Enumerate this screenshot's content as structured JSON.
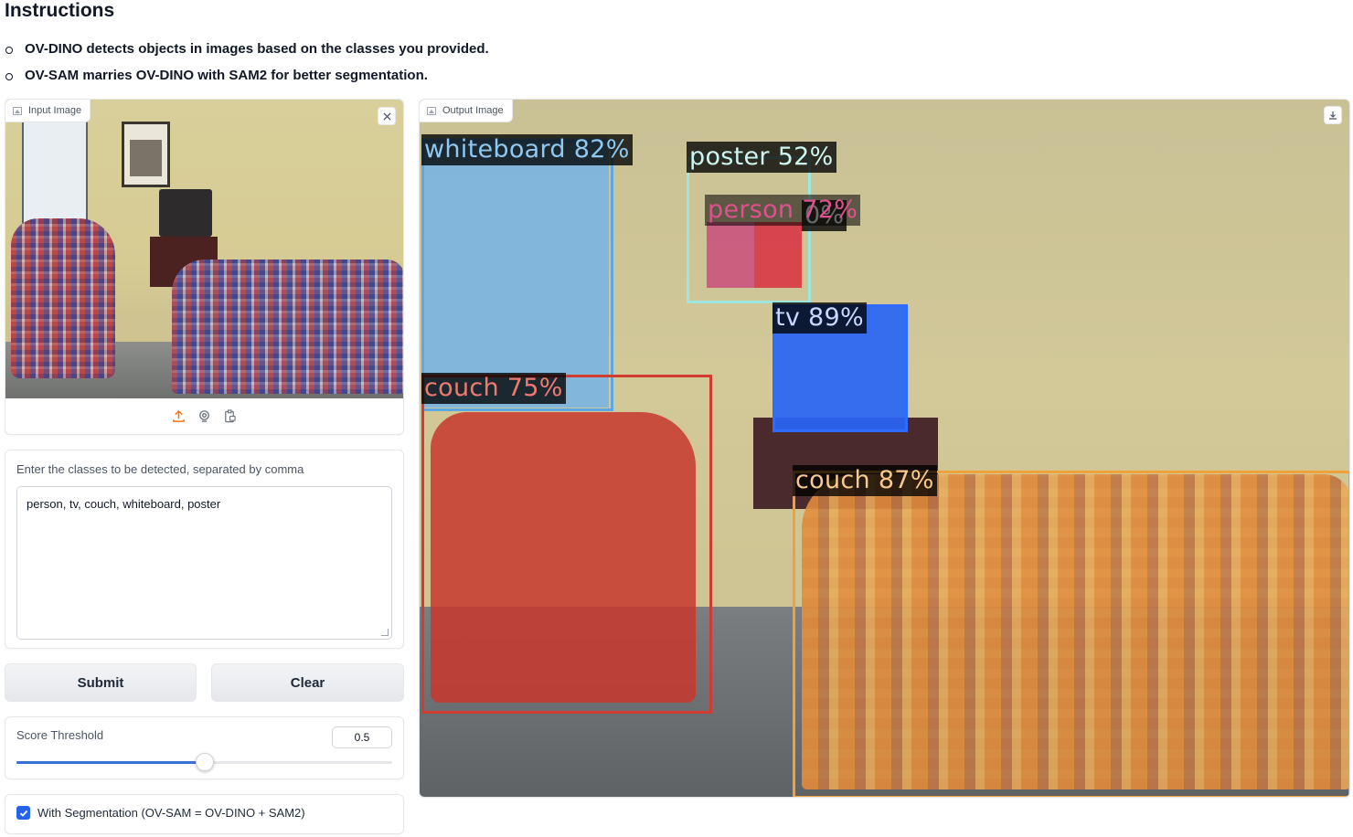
{
  "instructions": {
    "title": "Instructions",
    "items": [
      "OV-DINO detects objects in images based on the classes you provided.",
      "OV-SAM marries OV-DINO with SAM2 for better segmentation."
    ]
  },
  "input_image": {
    "label": "Input Image",
    "clear_icon": "close-icon",
    "source_icons": [
      "upload-icon",
      "webcam-icon",
      "clipboard-icon"
    ]
  },
  "classes": {
    "label": "Enter the classes to be detected, separated by comma",
    "value": "person, tv, couch, whiteboard, poster"
  },
  "buttons": {
    "submit": "Submit",
    "clear": "Clear"
  },
  "threshold": {
    "label": "Score Threshold",
    "value": "0.5",
    "fraction": 0.5
  },
  "segmentation": {
    "label": "With Segmentation (OV-SAM = OV-DINO + SAM2)",
    "checked": true
  },
  "output_image": {
    "label": "Output Image",
    "download_icon": "download-icon",
    "detections": [
      {
        "text": "whiteboard 82%",
        "color": "#5aa9e6"
      },
      {
        "text": "poster 52%",
        "color": "#9fe6e0"
      },
      {
        "text": "person 72%",
        "color": "#e0508f"
      },
      {
        "text": "0%",
        "color": "#e8e8e8"
      },
      {
        "text": "tv 89%",
        "color": "#2f6bff"
      },
      {
        "text": "couch 75%",
        "color": "#d23b2f"
      },
      {
        "text": "couch 87%",
        "color": "#f0a23a"
      }
    ]
  },
  "colors": {
    "accent": "#2563eb",
    "slider": "#3b6fd8"
  }
}
